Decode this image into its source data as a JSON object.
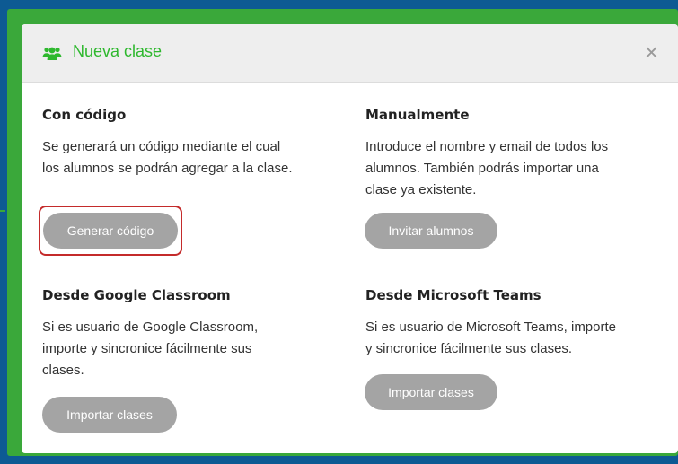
{
  "modal": {
    "title": "Nueva clase",
    "title_icon": "users-icon",
    "close_label": "×"
  },
  "sections": {
    "code": {
      "heading": "Con código",
      "line1": "Se generará un código mediante el cual",
      "line2": "los alumnos se podrán agregar a la clase.",
      "button": "Generar código"
    },
    "manual": {
      "heading": "Manualmente",
      "line1": "Introduce el nombre y email de todos los",
      "line2": "alumnos. También podrás importar una",
      "line3": "clase ya existente.",
      "button": "Invitar alumnos"
    },
    "google": {
      "heading": "Desde Google Classroom",
      "line1": "Si es usuario de Google Classroom,",
      "line2": "importe y sincronice fácilmente sus",
      "line3": "clases.",
      "button": "Importar clases"
    },
    "teams": {
      "heading": "Desde Microsoft Teams",
      "line1": "Si es usuario de Microsoft Teams, importe",
      "line2": "y sincronice fácilmente sus clases.",
      "button": "Importar clases"
    }
  },
  "colors": {
    "accent_green": "#2eb82e",
    "button_gray": "#a4a4a4",
    "highlight_red": "#c42b2b",
    "background_blue": "#0d5a93"
  }
}
